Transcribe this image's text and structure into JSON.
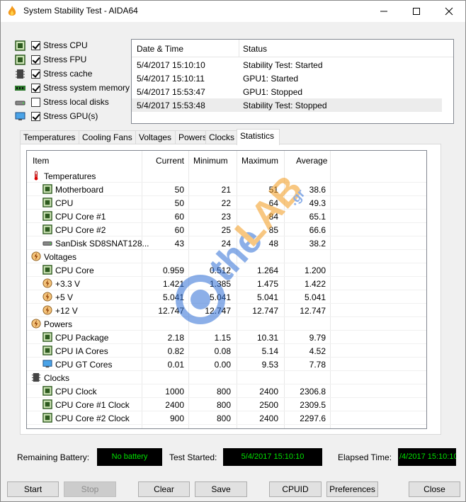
{
  "window": {
    "title": "System Stability Test - AIDA64"
  },
  "stress_options": [
    {
      "label": "Stress CPU",
      "checked": true,
      "icon": "cpu-chip-icon"
    },
    {
      "label": "Stress FPU",
      "checked": true,
      "icon": "fpu-icon"
    },
    {
      "label": "Stress cache",
      "checked": true,
      "icon": "cache-chip-icon"
    },
    {
      "label": "Stress system memory",
      "checked": true,
      "icon": "memory-module-icon"
    },
    {
      "label": "Stress local disks",
      "checked": false,
      "icon": "disk-drive-icon"
    },
    {
      "label": "Stress GPU(s)",
      "checked": true,
      "icon": "monitor-icon"
    }
  ],
  "log": {
    "col_datetime": "Date & Time",
    "col_status": "Status",
    "rows": [
      {
        "datetime": "5/4/2017 15:10:10",
        "status": "Stability Test: Started"
      },
      {
        "datetime": "5/4/2017 15:10:11",
        "status": "GPU1: Started"
      },
      {
        "datetime": "5/4/2017 15:53:47",
        "status": "GPU1: Stopped"
      },
      {
        "datetime": "5/4/2017 15:53:48",
        "status": "Stability Test: Stopped"
      }
    ]
  },
  "tabs": [
    "Temperatures",
    "Cooling Fans",
    "Voltages",
    "Powers",
    "Clocks",
    "Statistics"
  ],
  "active_tab": "Statistics",
  "stats": {
    "headers": {
      "item": "Item",
      "current": "Current",
      "minimum": "Minimum",
      "maximum": "Maximum",
      "average": "Average"
    },
    "groups": [
      {
        "label": "Temperatures",
        "icon": "thermometer-icon",
        "rows": [
          {
            "item": "Motherboard",
            "icon": "motherboard-icon",
            "current": "50",
            "minimum": "21",
            "maximum": "51",
            "average": "38.6"
          },
          {
            "item": "CPU",
            "icon": "cpu-chip-icon",
            "current": "50",
            "minimum": "22",
            "maximum": "64",
            "average": "49.3"
          },
          {
            "item": "CPU Core #1",
            "icon": "cpu-chip-icon",
            "current": "60",
            "minimum": "23",
            "maximum": "84",
            "average": "65.1"
          },
          {
            "item": "CPU Core #2",
            "icon": "cpu-chip-icon",
            "current": "60",
            "minimum": "25",
            "maximum": "85",
            "average": "66.6"
          },
          {
            "item": "SanDisk SD8SNAT128...",
            "icon": "disk-drive-icon",
            "current": "43",
            "minimum": "24",
            "maximum": "48",
            "average": "38.2"
          }
        ]
      },
      {
        "label": "Voltages",
        "icon": "voltage-icon",
        "rows": [
          {
            "item": "CPU Core",
            "icon": "cpu-chip-icon",
            "current": "0.959",
            "minimum": "0.512",
            "maximum": "1.264",
            "average": "1.200"
          },
          {
            "item": "+3.3 V",
            "icon": "voltage-icon",
            "current": "1.421",
            "minimum": "1.385",
            "maximum": "1.475",
            "average": "1.422"
          },
          {
            "item": "+5 V",
            "icon": "voltage-icon",
            "current": "5.041",
            "minimum": "5.041",
            "maximum": "5.041",
            "average": "5.041"
          },
          {
            "item": "+12 V",
            "icon": "voltage-icon",
            "current": "12.747",
            "minimum": "12.747",
            "maximum": "12.747",
            "average": "12.747"
          }
        ]
      },
      {
        "label": "Powers",
        "icon": "voltage-icon",
        "rows": [
          {
            "item": "CPU Package",
            "icon": "cpu-chip-icon",
            "current": "2.18",
            "minimum": "1.15",
            "maximum": "10.31",
            "average": "9.79"
          },
          {
            "item": "CPU IA Cores",
            "icon": "cpu-chip-icon",
            "current": "0.82",
            "minimum": "0.08",
            "maximum": "5.14",
            "average": "4.52"
          },
          {
            "item": "CPU GT Cores",
            "icon": "monitor-icon",
            "current": "0.01",
            "minimum": "0.00",
            "maximum": "9.53",
            "average": "7.78"
          }
        ]
      },
      {
        "label": "Clocks",
        "icon": "clock-chip-icon",
        "rows": [
          {
            "item": "CPU Clock",
            "icon": "cpu-chip-icon",
            "current": "1000",
            "minimum": "800",
            "maximum": "2400",
            "average": "2306.8"
          },
          {
            "item": "CPU Core #1 Clock",
            "icon": "cpu-chip-icon",
            "current": "2400",
            "minimum": "800",
            "maximum": "2500",
            "average": "2309.5"
          },
          {
            "item": "CPU Core #2 Clock",
            "icon": "cpu-chip-icon",
            "current": "900",
            "minimum": "800",
            "maximum": "2400",
            "average": "2297.6"
          }
        ]
      }
    ]
  },
  "status_bar": {
    "battery_label": "Remaining Battery:",
    "battery_value": "No battery",
    "started_label": "Test Started:",
    "started_value": "5/4/2017 15:10:10",
    "elapsed_label": "Elapsed Time:",
    "elapsed_value": "/4/2017 15:10:10"
  },
  "buttons": {
    "start": "Start",
    "stop": "Stop",
    "clear": "Clear",
    "save": "Save",
    "cpuid": "CPUID",
    "preferences": "Preferences",
    "close": "Close"
  },
  "watermark_text": "theLAB.gr",
  "colors": {
    "led_text": "#00e000",
    "led_bg": "#000000",
    "accent_watermark": "#2f6fd6"
  }
}
